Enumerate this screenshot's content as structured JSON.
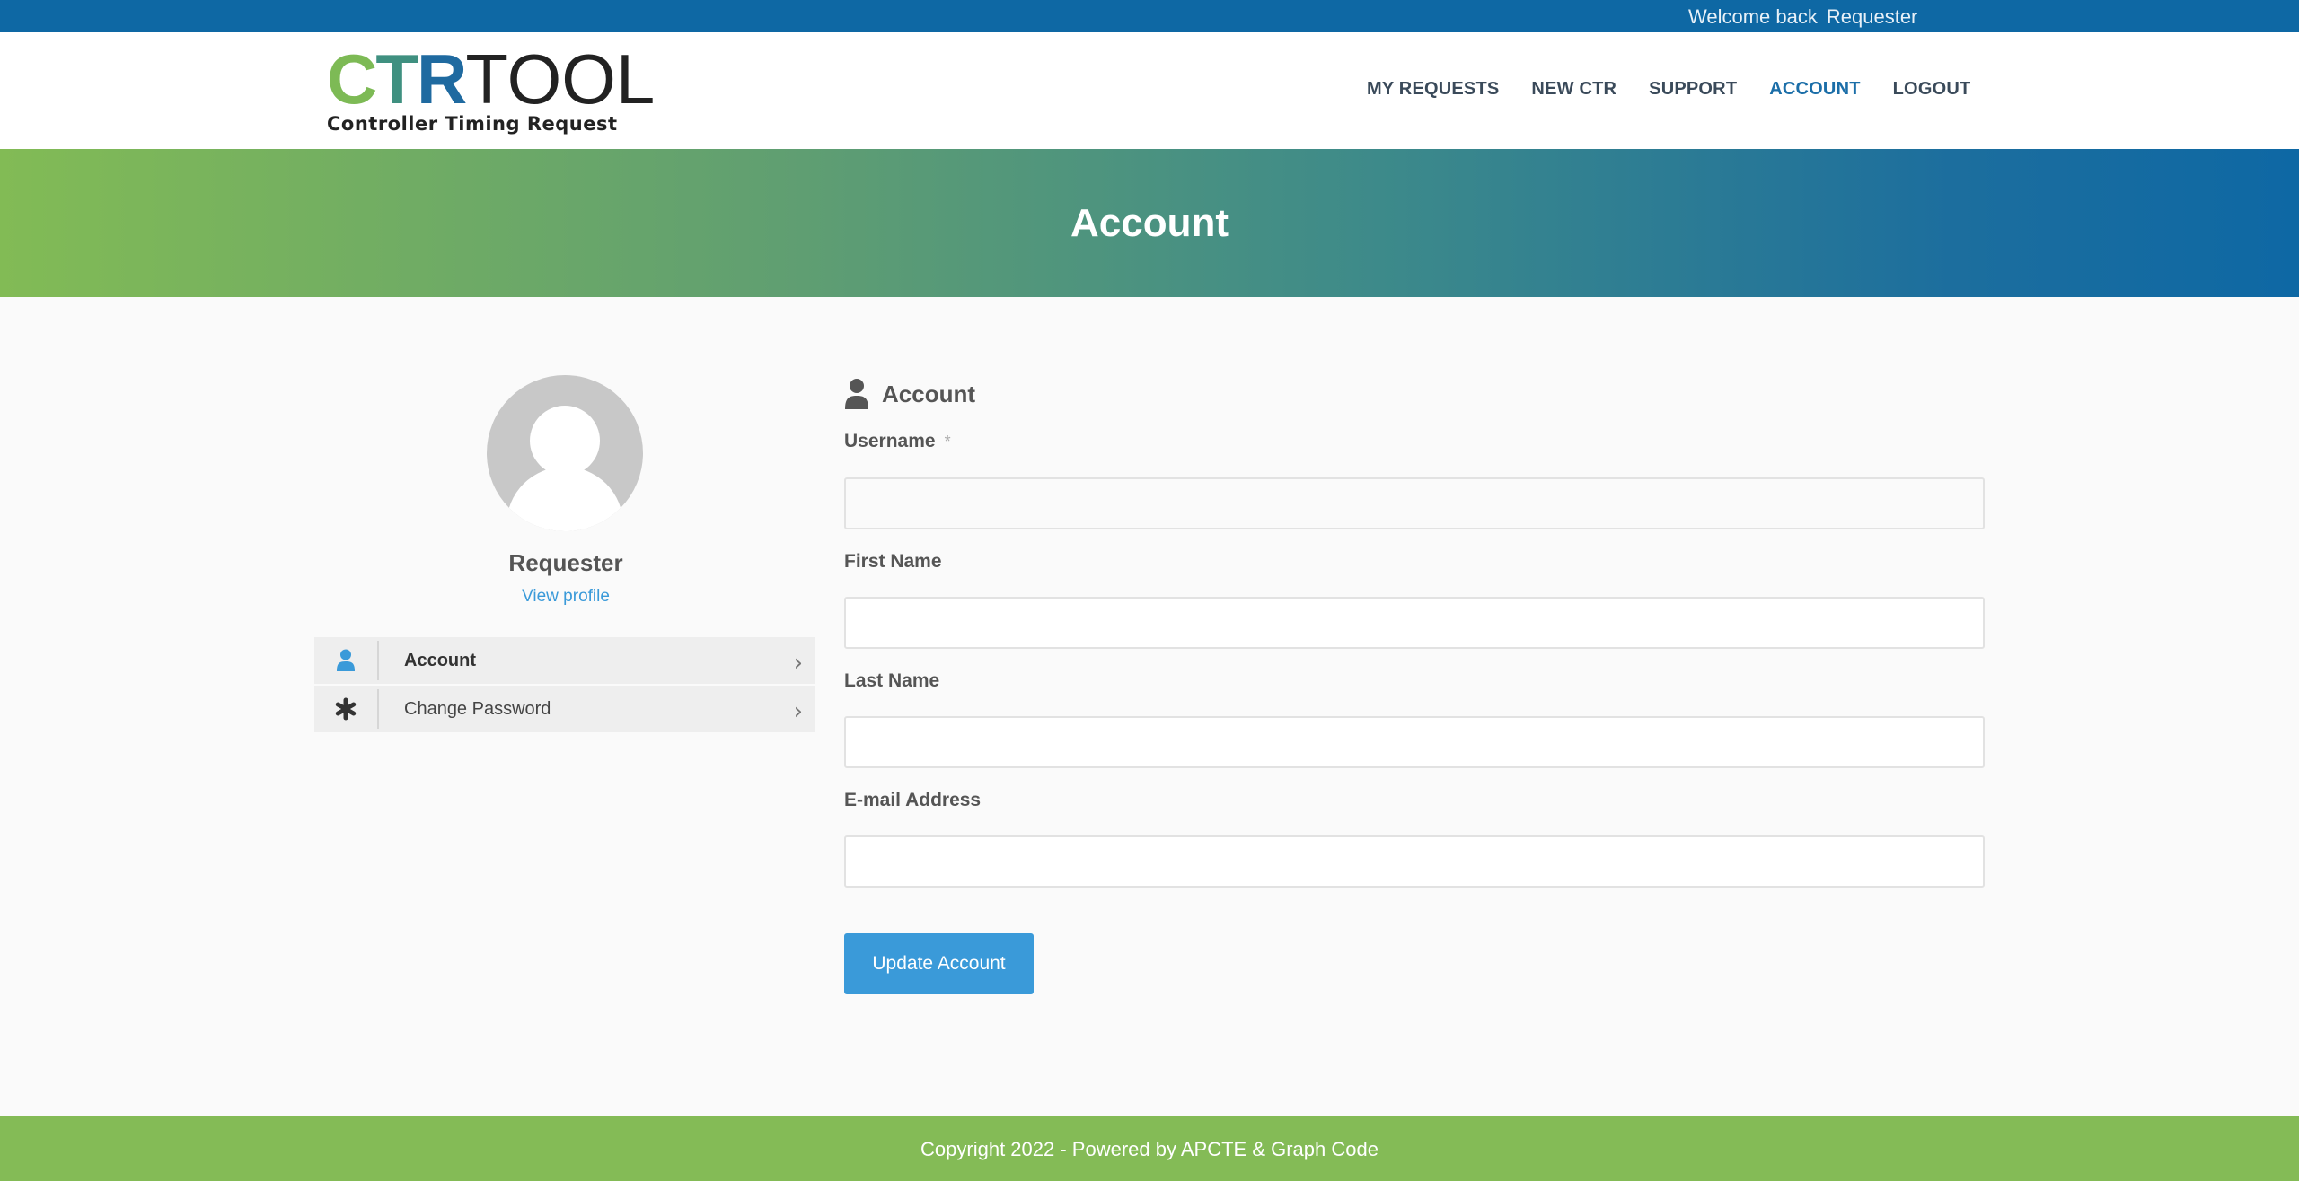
{
  "topbar": {
    "welcome_prefix": "Welcome back",
    "user_name": "Requester"
  },
  "logo": {
    "mark_c": "C",
    "mark_t": "T",
    "mark_r": "R",
    "mark_tool": "TOOL",
    "subtitle": "Controller Timing Request"
  },
  "nav": {
    "items": [
      {
        "label": "MY REQUESTS"
      },
      {
        "label": "NEW CTR"
      },
      {
        "label": "SUPPORT"
      },
      {
        "label": "ACCOUNT",
        "active": true
      },
      {
        "label": "LOGOUT"
      }
    ]
  },
  "banner": {
    "title": "Account"
  },
  "profile": {
    "name": "Requester",
    "view_profile_label": "View profile"
  },
  "sidebar_menu": [
    {
      "label": "Account",
      "icon": "user-icon",
      "active": true
    },
    {
      "label": "Change Password",
      "icon": "asterisk-icon",
      "active": false
    }
  ],
  "form": {
    "title": "Account",
    "username": {
      "label": "Username",
      "required_mark": "*",
      "value": ""
    },
    "first_name": {
      "label": "First Name",
      "value": ""
    },
    "last_name": {
      "label": "Last Name",
      "value": ""
    },
    "email": {
      "label": "E-mail Address",
      "value": ""
    },
    "submit_label": "Update Account"
  },
  "footer": {
    "text": "Copyright 2022 - Powered by APCTE & Graph Code"
  },
  "colors": {
    "primary_blue": "#0e68a4",
    "accent_blue": "#3a9ad9",
    "brand_green": "#84bb56"
  }
}
